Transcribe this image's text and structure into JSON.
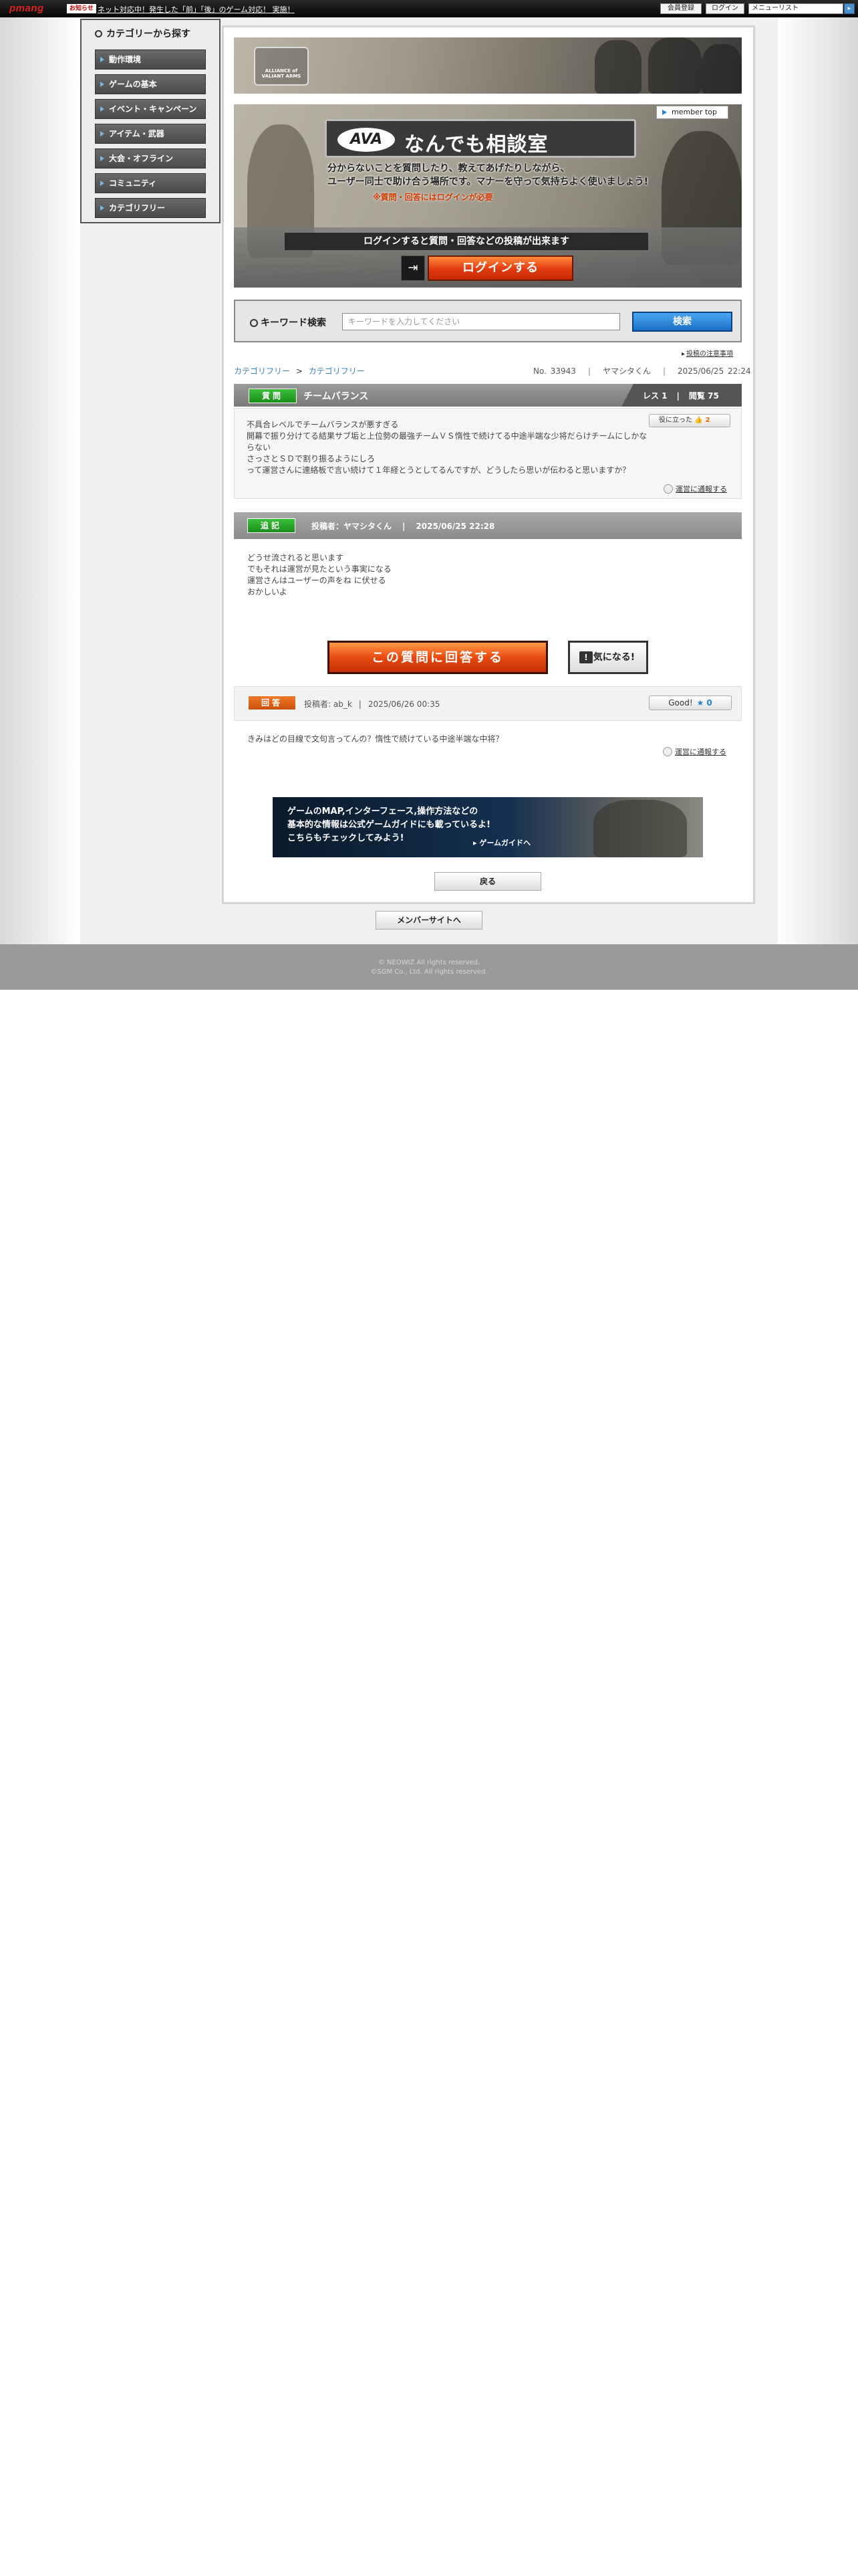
{
  "topbar": {
    "logo": "pmang",
    "notice_badge": "お知らせ",
    "notice_text": "ネット対応中！発生した「前」「後」のゲーム対応！ 実施！",
    "buttons": [
      "会員登録",
      "ログイン"
    ],
    "menu_select": "メニューリスト",
    "go_label": "GO"
  },
  "sidebar": {
    "title": "カテゴリーから探す",
    "items": [
      {
        "label": "動作環境"
      },
      {
        "label": "ゲームの基本"
      },
      {
        "label": "イベント・キャンペーン"
      },
      {
        "label": "アイテム・武器"
      },
      {
        "label": "大会・オフライン"
      },
      {
        "label": "コミュニティ"
      },
      {
        "label": "カテゴリフリー"
      }
    ]
  },
  "banner": {
    "emblem_text": "ALLIANCE of VALIANT ARMS"
  },
  "hero": {
    "member_top": "member top",
    "ava_mark": "AVA",
    "title": "なんでも相談室",
    "desc_line1": "分からないことを質問したり、教えてあげたりしながら、",
    "desc_line2": "ユーザー同士で助け合う場所です。マナーを守って気持ちよく使いましょう!",
    "warning": "※質問・回答にはログインが必要",
    "login_note": "ログインすると質問・回答などの投稿が出来ます",
    "login_button": "ログインする"
  },
  "search": {
    "label": "キーワード検索",
    "placeholder": "キーワードを入力してください",
    "button": "検索"
  },
  "caution_link": "投稿の注意事項",
  "breadcrumb": {
    "items": [
      "カテゴリフリー",
      "カテゴリフリー"
    ],
    "sep": ">"
  },
  "post_meta": {
    "number": "No. 33943",
    "author": "ヤマシタくん",
    "datetime": "2025/06/25 22:24"
  },
  "question": {
    "label": "質問",
    "title": "チームバランス",
    "res_label": "レス 1",
    "views_label": "閲覧 75",
    "body_lines": [
      "不具合レベルでチームバランスが悪すぎる",
      "開幕で振り分けてる結果サブ垢と上位勢の最強チームＶＳ惰性で続けてる中途半端な少将だらけチームにしかならない",
      "さっさとＳＤで割り振るようにしろ",
      "って運営さんに連絡板で言い続けて１年経とうとしてるんですが、どうしたら思いが伝わると思いますか？"
    ],
    "helpful_label": "役に立った",
    "helpful_count": "2",
    "report_link": "運営に通報する"
  },
  "addendum": {
    "label": "追記",
    "author": "投稿者：ヤマシタくん",
    "datetime": "2025/06/25 22:28",
    "body_lines": [
      "どうせ流されると思います",
      "でもそれは運営が見たという事実になる",
      "運営さんはユーザーの声をね  に伏せる",
      "おかしいよ"
    ]
  },
  "actions": {
    "answer_button": "この質問に回答する",
    "watch_button": "気になる!",
    "watch_icon": "!"
  },
  "answer": {
    "label": "回答",
    "author": "投稿者: ab_k",
    "datetime": "2025/06/26 00:35",
    "good_label": "Good!",
    "good_count": "0",
    "body": "きみはどの目線で文句言ってんの？惰性で続けている中途半端な中将？",
    "report_link": "運営に通報する"
  },
  "guide_banner": {
    "line1": "ゲームのMAP,インターフェース,操作方法などの",
    "line2": "基本的な情報は公式ゲームガイドにも載っているよ!",
    "line3": "こちらもチェックしてみよう!",
    "link": "ゲームガイドへ"
  },
  "back_button": "戻る",
  "member_site_button": "メンバーサイトへ",
  "footer": {
    "line1": "© NEOWIZ All rights reserved.",
    "line2": "©SGM Co., Ltd. All rights reserved."
  },
  "colors": {
    "accent_blue": "#2a7fd0",
    "cta_orange": "#e84a10",
    "label_green": "#1a8f1a",
    "label_orange": "#c8500a"
  }
}
